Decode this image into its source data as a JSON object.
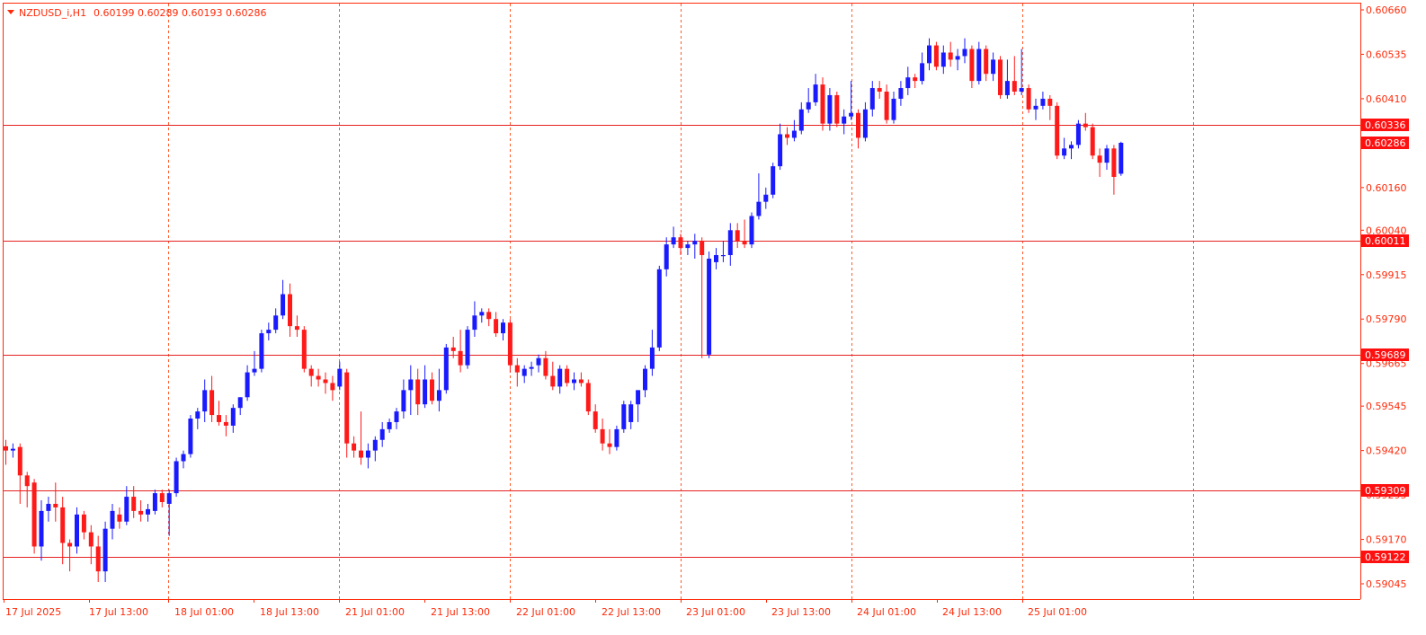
{
  "window": {
    "symbol_label": "NZDUSD_i,H1",
    "ohlc_label": "0.60199 0.60289 0.60193 0.60286"
  },
  "colors": {
    "bull": "#1a1aff",
    "bear": "#ff1a1a",
    "axis": "#ff2a0a",
    "grid": "#ff5a2a",
    "hline": "#e62020",
    "tag_bg": "#ff1010",
    "tag_text": "#ffffff"
  },
  "price_axis": {
    "ticks": [
      "0.60660",
      "0.60535",
      "0.60410",
      "0.60286",
      "0.60160",
      "0.60040",
      "0.59915",
      "0.59790",
      "0.59665",
      "0.59545",
      "0.59420",
      "0.59295",
      "0.59170",
      "0.59045"
    ]
  },
  "time_axis": {
    "labels": [
      "17 Jul 2025",
      "17 Jul 13:00",
      "18 Jul 01:00",
      "18 Jul 13:00",
      "21 Jul 01:00",
      "21 Jul 13:00",
      "22 Jul 01:00",
      "22 Jul 13:00",
      "23 Jul 01:00",
      "23 Jul 13:00",
      "24 Jul 01:00",
      "24 Jul 13:00",
      "25 Jul 01:00"
    ]
  },
  "horizontal_levels": [
    "0.60336",
    "0.60011",
    "0.59689",
    "0.59309",
    "0.59122"
  ],
  "current_price_tag": "0.60286",
  "chart_data": {
    "type": "candlestick",
    "title": "NZDUSD_i,H1",
    "timeframe": "H1",
    "ylim": [
      0.59,
      0.6068
    ],
    "x_start": "17 Jul 2025 00:00",
    "candles": [
      {
        "o": 0.59432,
        "h": 0.5945,
        "l": 0.5938,
        "c": 0.5942
      },
      {
        "o": 0.5942,
        "h": 0.5944,
        "l": 0.594,
        "c": 0.59425
      },
      {
        "o": 0.5943,
        "h": 0.5944,
        "l": 0.5927,
        "c": 0.5935
      },
      {
        "o": 0.5935,
        "h": 0.5936,
        "l": 0.5926,
        "c": 0.5932
      },
      {
        "o": 0.5933,
        "h": 0.5934,
        "l": 0.5913,
        "c": 0.5915
      },
      {
        "o": 0.5915,
        "h": 0.5928,
        "l": 0.5911,
        "c": 0.5925
      },
      {
        "o": 0.5925,
        "h": 0.5929,
        "l": 0.5922,
        "c": 0.5927
      },
      {
        "o": 0.5927,
        "h": 0.5933,
        "l": 0.5922,
        "c": 0.5926
      },
      {
        "o": 0.5926,
        "h": 0.5929,
        "l": 0.591,
        "c": 0.5916
      },
      {
        "o": 0.5916,
        "h": 0.5917,
        "l": 0.5908,
        "c": 0.5915
      },
      {
        "o": 0.5915,
        "h": 0.5926,
        "l": 0.5913,
        "c": 0.5924
      },
      {
        "o": 0.5924,
        "h": 0.5925,
        "l": 0.5917,
        "c": 0.5919
      },
      {
        "o": 0.5919,
        "h": 0.5921,
        "l": 0.591,
        "c": 0.5915
      },
      {
        "o": 0.5915,
        "h": 0.5918,
        "l": 0.5905,
        "c": 0.5908
      },
      {
        "o": 0.5908,
        "h": 0.5922,
        "l": 0.5905,
        "c": 0.592
      },
      {
        "o": 0.592,
        "h": 0.5927,
        "l": 0.5917,
        "c": 0.5925
      },
      {
        "o": 0.5924,
        "h": 0.5926,
        "l": 0.592,
        "c": 0.5922
      },
      {
        "o": 0.5922,
        "h": 0.5932,
        "l": 0.5921,
        "c": 0.5929
      },
      {
        "o": 0.5929,
        "h": 0.5932,
        "l": 0.5923,
        "c": 0.5925
      },
      {
        "o": 0.5925,
        "h": 0.5928,
        "l": 0.5922,
        "c": 0.5924
      },
      {
        "o": 0.5924,
        "h": 0.5927,
        "l": 0.5922,
        "c": 0.59255
      },
      {
        "o": 0.5925,
        "h": 0.5931,
        "l": 0.5924,
        "c": 0.593
      },
      {
        "o": 0.593,
        "h": 0.5931,
        "l": 0.5926,
        "c": 0.59275
      },
      {
        "o": 0.5927,
        "h": 0.5931,
        "l": 0.5918,
        "c": 0.593
      },
      {
        "o": 0.593,
        "h": 0.594,
        "l": 0.5929,
        "c": 0.5939
      },
      {
        "o": 0.5939,
        "h": 0.5942,
        "l": 0.5937,
        "c": 0.5941
      },
      {
        "o": 0.5941,
        "h": 0.5952,
        "l": 0.594,
        "c": 0.5951
      },
      {
        "o": 0.5951,
        "h": 0.5954,
        "l": 0.5948,
        "c": 0.5953
      },
      {
        "o": 0.5953,
        "h": 0.5962,
        "l": 0.595,
        "c": 0.5959
      },
      {
        "o": 0.5959,
        "h": 0.5963,
        "l": 0.595,
        "c": 0.5952
      },
      {
        "o": 0.5952,
        "h": 0.5956,
        "l": 0.5949,
        "c": 0.595
      },
      {
        "o": 0.595,
        "h": 0.5952,
        "l": 0.5946,
        "c": 0.5949
      },
      {
        "o": 0.5949,
        "h": 0.5955,
        "l": 0.5947,
        "c": 0.5954
      },
      {
        "o": 0.5954,
        "h": 0.5957,
        "l": 0.5952,
        "c": 0.5957
      },
      {
        "o": 0.5957,
        "h": 0.5966,
        "l": 0.5956,
        "c": 0.5964
      },
      {
        "o": 0.5964,
        "h": 0.597,
        "l": 0.5963,
        "c": 0.5965
      },
      {
        "o": 0.5965,
        "h": 0.5976,
        "l": 0.5964,
        "c": 0.5975
      },
      {
        "o": 0.5975,
        "h": 0.5978,
        "l": 0.5973,
        "c": 0.5976
      },
      {
        "o": 0.5976,
        "h": 0.5982,
        "l": 0.5975,
        "c": 0.598
      },
      {
        "o": 0.598,
        "h": 0.599,
        "l": 0.5979,
        "c": 0.5986
      },
      {
        "o": 0.5986,
        "h": 0.5989,
        "l": 0.5974,
        "c": 0.5977
      },
      {
        "o": 0.5977,
        "h": 0.598,
        "l": 0.5974,
        "c": 0.5976
      },
      {
        "o": 0.5976,
        "h": 0.5977,
        "l": 0.5964,
        "c": 0.5965
      },
      {
        "o": 0.5965,
        "h": 0.5966,
        "l": 0.596,
        "c": 0.5963
      },
      {
        "o": 0.5963,
        "h": 0.5965,
        "l": 0.596,
        "c": 0.5962
      },
      {
        "o": 0.5962,
        "h": 0.5964,
        "l": 0.5958,
        "c": 0.5961
      },
      {
        "o": 0.5961,
        "h": 0.5963,
        "l": 0.5956,
        "c": 0.5959
      },
      {
        "o": 0.596,
        "h": 0.5967,
        "l": 0.5959,
        "c": 0.5965
      },
      {
        "o": 0.5964,
        "h": 0.5965,
        "l": 0.594,
        "c": 0.5944
      },
      {
        "o": 0.5944,
        "h": 0.5946,
        "l": 0.594,
        "c": 0.5942
      },
      {
        "o": 0.5942,
        "h": 0.5953,
        "l": 0.5938,
        "c": 0.594
      },
      {
        "o": 0.594,
        "h": 0.5944,
        "l": 0.5937,
        "c": 0.5942
      },
      {
        "o": 0.5942,
        "h": 0.5946,
        "l": 0.5939,
        "c": 0.5945
      },
      {
        "o": 0.5945,
        "h": 0.595,
        "l": 0.5943,
        "c": 0.5948
      },
      {
        "o": 0.5948,
        "h": 0.5951,
        "l": 0.5947,
        "c": 0.595
      },
      {
        "o": 0.595,
        "h": 0.5954,
        "l": 0.5948,
        "c": 0.5953
      },
      {
        "o": 0.5953,
        "h": 0.5962,
        "l": 0.5951,
        "c": 0.5959
      },
      {
        "o": 0.5959,
        "h": 0.5966,
        "l": 0.5952,
        "c": 0.5962
      },
      {
        "o": 0.5962,
        "h": 0.5965,
        "l": 0.5952,
        "c": 0.5955
      },
      {
        "o": 0.5955,
        "h": 0.5966,
        "l": 0.5954,
        "c": 0.5962
      },
      {
        "o": 0.5962,
        "h": 0.5964,
        "l": 0.5955,
        "c": 0.5956
      },
      {
        "o": 0.5956,
        "h": 0.5965,
        "l": 0.5953,
        "c": 0.5959
      },
      {
        "o": 0.5959,
        "h": 0.5972,
        "l": 0.5958,
        "c": 0.5971
      },
      {
        "o": 0.5971,
        "h": 0.5974,
        "l": 0.5968,
        "c": 0.597
      },
      {
        "o": 0.597,
        "h": 0.5976,
        "l": 0.5964,
        "c": 0.5966
      },
      {
        "o": 0.5966,
        "h": 0.5977,
        "l": 0.5965,
        "c": 0.5976
      },
      {
        "o": 0.5976,
        "h": 0.5984,
        "l": 0.5974,
        "c": 0.598
      },
      {
        "o": 0.598,
        "h": 0.5982,
        "l": 0.5978,
        "c": 0.5981
      },
      {
        "o": 0.5981,
        "h": 0.5982,
        "l": 0.5977,
        "c": 0.5979
      },
      {
        "o": 0.5979,
        "h": 0.5981,
        "l": 0.5974,
        "c": 0.5975
      },
      {
        "o": 0.5975,
        "h": 0.5979,
        "l": 0.5973,
        "c": 0.5978
      },
      {
        "o": 0.5978,
        "h": 0.5979,
        "l": 0.5964,
        "c": 0.5966
      },
      {
        "o": 0.5966,
        "h": 0.5968,
        "l": 0.596,
        "c": 0.5964
      },
      {
        "o": 0.5963,
        "h": 0.5966,
        "l": 0.5961,
        "c": 0.5965
      },
      {
        "o": 0.5965,
        "h": 0.5967,
        "l": 0.5963,
        "c": 0.59655
      },
      {
        "o": 0.5966,
        "h": 0.5969,
        "l": 0.5964,
        "c": 0.5968
      },
      {
        "o": 0.5968,
        "h": 0.597,
        "l": 0.5962,
        "c": 0.5963
      },
      {
        "o": 0.5963,
        "h": 0.5967,
        "l": 0.5959,
        "c": 0.596
      },
      {
        "o": 0.596,
        "h": 0.5966,
        "l": 0.5958,
        "c": 0.5965
      },
      {
        "o": 0.5965,
        "h": 0.5966,
        "l": 0.596,
        "c": 0.5961
      },
      {
        "o": 0.5961,
        "h": 0.5964,
        "l": 0.5959,
        "c": 0.5962
      },
      {
        "o": 0.5962,
        "h": 0.5964,
        "l": 0.596,
        "c": 0.5961
      },
      {
        "o": 0.5961,
        "h": 0.5962,
        "l": 0.5952,
        "c": 0.5953
      },
      {
        "o": 0.5953,
        "h": 0.5955,
        "l": 0.5947,
        "c": 0.5948
      },
      {
        "o": 0.5948,
        "h": 0.5951,
        "l": 0.5942,
        "c": 0.5944
      },
      {
        "o": 0.5944,
        "h": 0.5948,
        "l": 0.5941,
        "c": 0.5943
      },
      {
        "o": 0.5943,
        "h": 0.5949,
        "l": 0.5942,
        "c": 0.5948
      },
      {
        "o": 0.5948,
        "h": 0.5956,
        "l": 0.5947,
        "c": 0.5955
      },
      {
        "o": 0.595,
        "h": 0.5956,
        "l": 0.5948,
        "c": 0.5955
      },
      {
        "o": 0.5955,
        "h": 0.5959,
        "l": 0.595,
        "c": 0.5959
      },
      {
        "o": 0.5959,
        "h": 0.5966,
        "l": 0.5957,
        "c": 0.5965
      },
      {
        "o": 0.5965,
        "h": 0.5976,
        "l": 0.5963,
        "c": 0.5971
      },
      {
        "o": 0.5971,
        "h": 0.5994,
        "l": 0.597,
        "c": 0.5993
      },
      {
        "o": 0.5993,
        "h": 0.6002,
        "l": 0.5991,
        "c": 0.6
      },
      {
        "o": 0.6,
        "h": 0.6005,
        "l": 0.5999,
        "c": 0.6002
      },
      {
        "o": 0.6002,
        "h": 0.6003,
        "l": 0.5997,
        "c": 0.5999
      },
      {
        "o": 0.5999,
        "h": 0.6001,
        "l": 0.5997,
        "c": 0.6
      },
      {
        "o": 0.6,
        "h": 0.6003,
        "l": 0.5996,
        "c": 0.6001
      },
      {
        "o": 0.6001,
        "h": 0.6002,
        "l": 0.5968,
        "c": 0.5997
      },
      {
        "o": 0.5969,
        "h": 0.5998,
        "l": 0.5968,
        "c": 0.5996
      },
      {
        "o": 0.5995,
        "h": 0.5999,
        "l": 0.5993,
        "c": 0.5997
      },
      {
        "o": 0.5997,
        "h": 0.6001,
        "l": 0.5995,
        "c": 0.5997
      },
      {
        "o": 0.5997,
        "h": 0.6006,
        "l": 0.5994,
        "c": 0.6004
      },
      {
        "o": 0.6004,
        "h": 0.6006,
        "l": 0.5999,
        "c": 0.6001
      },
      {
        "o": 0.6001,
        "h": 0.6007,
        "l": 0.5999,
        "c": 0.6
      },
      {
        "o": 0.6,
        "h": 0.6009,
        "l": 0.5999,
        "c": 0.6008
      },
      {
        "o": 0.6008,
        "h": 0.602,
        "l": 0.6007,
        "c": 0.6012
      },
      {
        "o": 0.6012,
        "h": 0.6016,
        "l": 0.601,
        "c": 0.6014
      },
      {
        "o": 0.6014,
        "h": 0.6023,
        "l": 0.6013,
        "c": 0.6022
      },
      {
        "o": 0.6022,
        "h": 0.6034,
        "l": 0.6021,
        "c": 0.6031
      },
      {
        "o": 0.6031,
        "h": 0.6033,
        "l": 0.6028,
        "c": 0.603
      },
      {
        "o": 0.603,
        "h": 0.6035,
        "l": 0.6029,
        "c": 0.6032
      },
      {
        "o": 0.6032,
        "h": 0.604,
        "l": 0.6031,
        "c": 0.6038
      },
      {
        "o": 0.6038,
        "h": 0.6044,
        "l": 0.6037,
        "c": 0.604
      },
      {
        "o": 0.604,
        "h": 0.6048,
        "l": 0.6039,
        "c": 0.6045
      },
      {
        "o": 0.6045,
        "h": 0.6047,
        "l": 0.6032,
        "c": 0.6034
      },
      {
        "o": 0.6034,
        "h": 0.6044,
        "l": 0.6032,
        "c": 0.6042
      },
      {
        "o": 0.6042,
        "h": 0.6043,
        "l": 0.6033,
        "c": 0.6034
      },
      {
        "o": 0.6034,
        "h": 0.6038,
        "l": 0.6031,
        "c": 0.6036
      },
      {
        "o": 0.6036,
        "h": 0.6046,
        "l": 0.6035,
        "c": 0.6037
      },
      {
        "o": 0.6037,
        "h": 0.6038,
        "l": 0.6027,
        "c": 0.603
      },
      {
        "o": 0.603,
        "h": 0.604,
        "l": 0.6029,
        "c": 0.6038
      },
      {
        "o": 0.6038,
        "h": 0.6046,
        "l": 0.6036,
        "c": 0.6044
      },
      {
        "o": 0.6044,
        "h": 0.6046,
        "l": 0.6041,
        "c": 0.6043
      },
      {
        "o": 0.6043,
        "h": 0.6045,
        "l": 0.6034,
        "c": 0.6035
      },
      {
        "o": 0.6035,
        "h": 0.6043,
        "l": 0.6034,
        "c": 0.6041
      },
      {
        "o": 0.6041,
        "h": 0.6046,
        "l": 0.6039,
        "c": 0.6044
      },
      {
        "o": 0.6044,
        "h": 0.605,
        "l": 0.6042,
        "c": 0.6047
      },
      {
        "o": 0.6047,
        "h": 0.6048,
        "l": 0.6044,
        "c": 0.6046
      },
      {
        "o": 0.6046,
        "h": 0.6054,
        "l": 0.6045,
        "c": 0.6051
      },
      {
        "o": 0.6051,
        "h": 0.6058,
        "l": 0.6049,
        "c": 0.6056
      },
      {
        "o": 0.6056,
        "h": 0.6057,
        "l": 0.6049,
        "c": 0.605
      },
      {
        "o": 0.605,
        "h": 0.6056,
        "l": 0.6048,
        "c": 0.6054
      },
      {
        "o": 0.6054,
        "h": 0.6057,
        "l": 0.605,
        "c": 0.6052
      },
      {
        "o": 0.6052,
        "h": 0.6055,
        "l": 0.6049,
        "c": 0.6053
      },
      {
        "o": 0.6053,
        "h": 0.6058,
        "l": 0.6051,
        "c": 0.6055
      },
      {
        "o": 0.6055,
        "h": 0.6056,
        "l": 0.6044,
        "c": 0.6046
      },
      {
        "o": 0.6046,
        "h": 0.6057,
        "l": 0.6045,
        "c": 0.6055
      },
      {
        "o": 0.6055,
        "h": 0.6056,
        "l": 0.6046,
        "c": 0.6048
      },
      {
        "o": 0.6048,
        "h": 0.6054,
        "l": 0.6046,
        "c": 0.6052
      },
      {
        "o": 0.6052,
        "h": 0.6053,
        "l": 0.6041,
        "c": 0.6042
      },
      {
        "o": 0.6042,
        "h": 0.6052,
        "l": 0.6041,
        "c": 0.6046
      },
      {
        "o": 0.6046,
        "h": 0.6053,
        "l": 0.6042,
        "c": 0.6043
      },
      {
        "o": 0.6043,
        "h": 0.6055,
        "l": 0.6042,
        "c": 0.6044
      },
      {
        "o": 0.6044,
        "h": 0.6045,
        "l": 0.6037,
        "c": 0.6038
      },
      {
        "o": 0.6038,
        "h": 0.6041,
        "l": 0.6035,
        "c": 0.6039
      },
      {
        "o": 0.6039,
        "h": 0.6043,
        "l": 0.6038,
        "c": 0.6041
      },
      {
        "o": 0.6041,
        "h": 0.6042,
        "l": 0.6035,
        "c": 0.6039
      },
      {
        "o": 0.6039,
        "h": 0.604,
        "l": 0.6024,
        "c": 0.6025
      },
      {
        "o": 0.6025,
        "h": 0.603,
        "l": 0.6024,
        "c": 0.6027
      },
      {
        "o": 0.6027,
        "h": 0.6029,
        "l": 0.6024,
        "c": 0.6028
      },
      {
        "o": 0.6028,
        "h": 0.6035,
        "l": 0.6027,
        "c": 0.6034
      },
      {
        "o": 0.6034,
        "h": 0.6037,
        "l": 0.6032,
        "c": 0.6033
      },
      {
        "o": 0.6033,
        "h": 0.6034,
        "l": 0.6024,
        "c": 0.6025
      },
      {
        "o": 0.6025,
        "h": 0.6027,
        "l": 0.6019,
        "c": 0.6023
      },
      {
        "o": 0.6023,
        "h": 0.6028,
        "l": 0.6021,
        "c": 0.6027
      },
      {
        "o": 0.6027,
        "h": 0.6028,
        "l": 0.6014,
        "c": 0.6019
      },
      {
        "o": 0.60199,
        "h": 0.60289,
        "l": 0.60193,
        "c": 0.60286
      }
    ]
  }
}
